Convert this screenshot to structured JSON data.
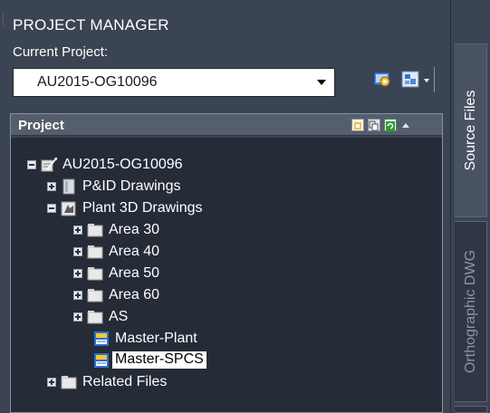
{
  "palette": {
    "title": "PROJECT MANAGER",
    "current_project_label": "Current Project:",
    "current_project_value": "AU2015-OG10096"
  },
  "project_panel": {
    "title": "Project"
  },
  "tree": {
    "root": {
      "label": "AU2015-OG10096",
      "icon": "project-icon"
    },
    "items": [
      {
        "label": "P&ID Drawings",
        "icon": "pid-folder-icon"
      },
      {
        "label": "Plant 3D Drawings",
        "icon": "plant3d-folder-icon"
      },
      {
        "label": "Area 30",
        "icon": "folder-icon"
      },
      {
        "label": "Area 40",
        "icon": "folder-icon"
      },
      {
        "label": "Area 50",
        "icon": "folder-icon"
      },
      {
        "label": "Area 60",
        "icon": "folder-icon"
      },
      {
        "label": "AS",
        "icon": "folder-icon"
      },
      {
        "label": "Master-Plant",
        "icon": "drawing-icon"
      },
      {
        "label": "Master-SPCS",
        "icon": "drawing-icon"
      },
      {
        "label": "Related Files",
        "icon": "folder-icon"
      }
    ]
  },
  "tabs": {
    "source_files": "Source Files",
    "orthographic_dwg": "Orthographic DWG"
  },
  "colors": {
    "panel_bg": "#3b4453",
    "tree_bg": "#252c37",
    "selection_bg": "#ffffff"
  }
}
